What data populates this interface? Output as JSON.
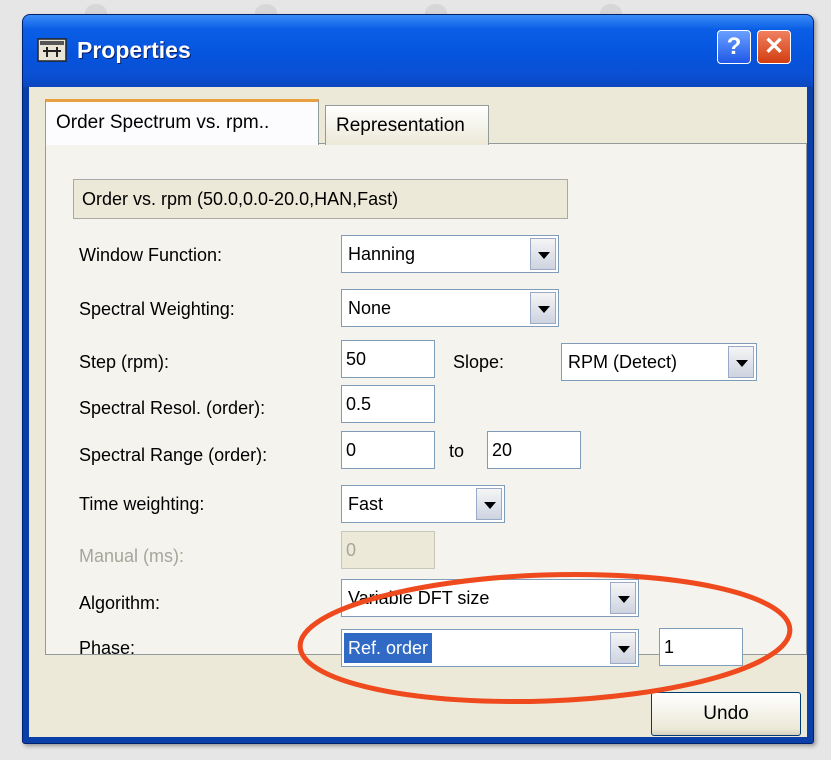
{
  "window": {
    "title": "Properties"
  },
  "tabs": [
    {
      "label": "Order Spectrum vs. rpm..",
      "active": true
    },
    {
      "label": "Representation",
      "active": false
    }
  ],
  "summary": "Order vs. rpm (50.0,0.0-20.0,HAN,Fast)",
  "form": {
    "window_function": {
      "label": "Window Function:",
      "value": "Hanning"
    },
    "spectral_weighting": {
      "label": "Spectral Weighting:",
      "value": "None"
    },
    "step": {
      "label": "Step (rpm):",
      "value": "50"
    },
    "slope": {
      "label": "Slope:",
      "value": "RPM (Detect)"
    },
    "spectral_resol": {
      "label": "Spectral Resol. (order):",
      "value": "0.5"
    },
    "spectral_range": {
      "label": "Spectral Range (order):",
      "from": "0",
      "to_label": "to",
      "to": "20"
    },
    "time_weighting": {
      "label": "Time weighting:",
      "value": "Fast"
    },
    "manual": {
      "label": "Manual (ms):",
      "value": "0"
    },
    "algorithm": {
      "label": "Algorithm:",
      "value": "Variable DFT size"
    },
    "phase": {
      "label": "Phase:",
      "value": "Ref. order",
      "ref_value": "1"
    }
  },
  "buttons": {
    "undo": "Undo"
  },
  "icons": {
    "help": "?",
    "close": "✕",
    "app": "properties-app-icon"
  },
  "colors": {
    "highlight": "#ef4a1e",
    "titlebar": "#0654de",
    "selection": "#316ac5"
  }
}
